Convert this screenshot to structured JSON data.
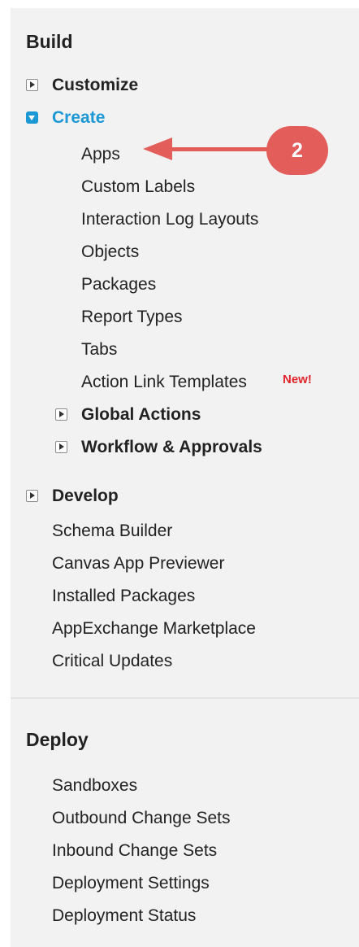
{
  "build": {
    "title": "Build",
    "customize": "Customize",
    "create": {
      "label": "Create",
      "items": [
        "Apps",
        "Custom Labels",
        "Interaction Log Layouts",
        "Objects",
        "Packages",
        "Report Types",
        "Tabs",
        "Action Link Templates"
      ],
      "new_badge": "New!",
      "groups": [
        "Global Actions",
        "Workflow & Approvals"
      ]
    },
    "develop": "Develop",
    "links": [
      "Schema Builder",
      "Canvas App Previewer",
      "Installed Packages",
      "AppExchange Marketplace",
      "Critical Updates"
    ]
  },
  "deploy": {
    "title": "Deploy",
    "links": [
      "Sandboxes",
      "Outbound Change Sets",
      "Inbound Change Sets",
      "Deployment Settings",
      "Deployment Status"
    ]
  },
  "callout": {
    "number": "2",
    "color": "#e35d5b"
  },
  "colors": {
    "panel_bg": "#f2f2f2",
    "link_blue": "#1c98d5",
    "new_red": "#e2232a"
  },
  "icons": {
    "collapsed": "triangle-right-icon",
    "expanded": "triangle-down-icon"
  }
}
